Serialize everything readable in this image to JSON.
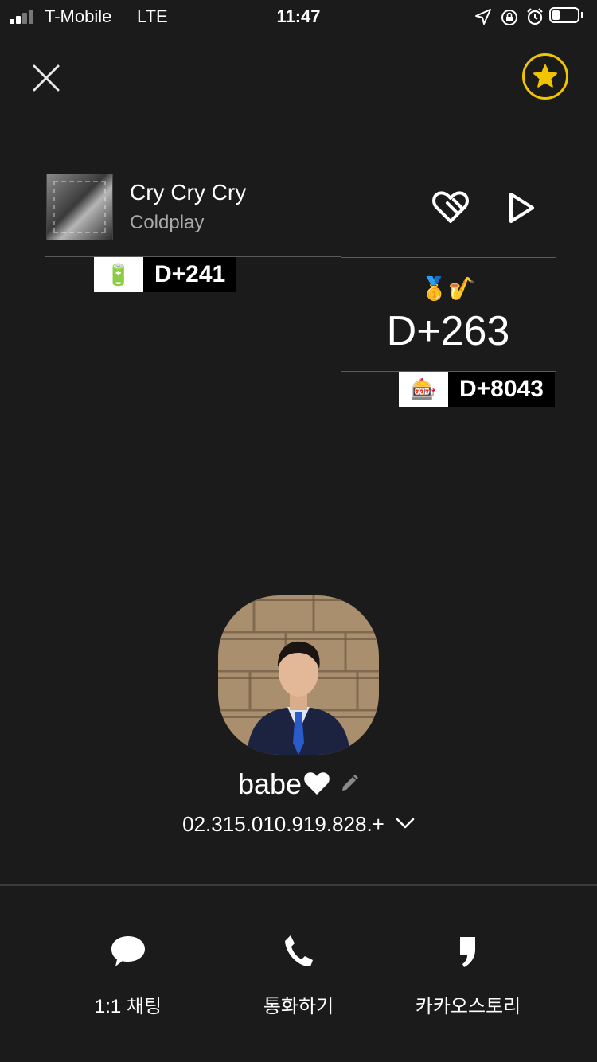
{
  "status_bar": {
    "carrier": "T-Mobile",
    "network": "LTE",
    "time": "11:47"
  },
  "music": {
    "song_title": "Cry Cry Cry",
    "artist": "Coldplay"
  },
  "dday": {
    "left_badge": {
      "icon": "battery-emoji",
      "emoji": "🔋",
      "label": "D+241"
    },
    "right_emojis": "🥇🎷",
    "right_main": "D+263",
    "right_badge": {
      "icon": "slot-machine-emoji",
      "emoji": "🎰",
      "label": "D+8043"
    }
  },
  "profile": {
    "name": "babe",
    "name_icon": "white-heart",
    "phone": "02.315.010.919.828.+"
  },
  "actions": [
    {
      "icon": "chat-bubble-icon",
      "label": "1:1 채팅"
    },
    {
      "icon": "phone-icon",
      "label": "통화하기"
    },
    {
      "icon": "kakaostory-icon",
      "label": "카카오스토리"
    }
  ],
  "colors": {
    "background": "#1b1b1b",
    "star_accent": "#f1c400",
    "text_secondary": "#a9a9a9"
  }
}
